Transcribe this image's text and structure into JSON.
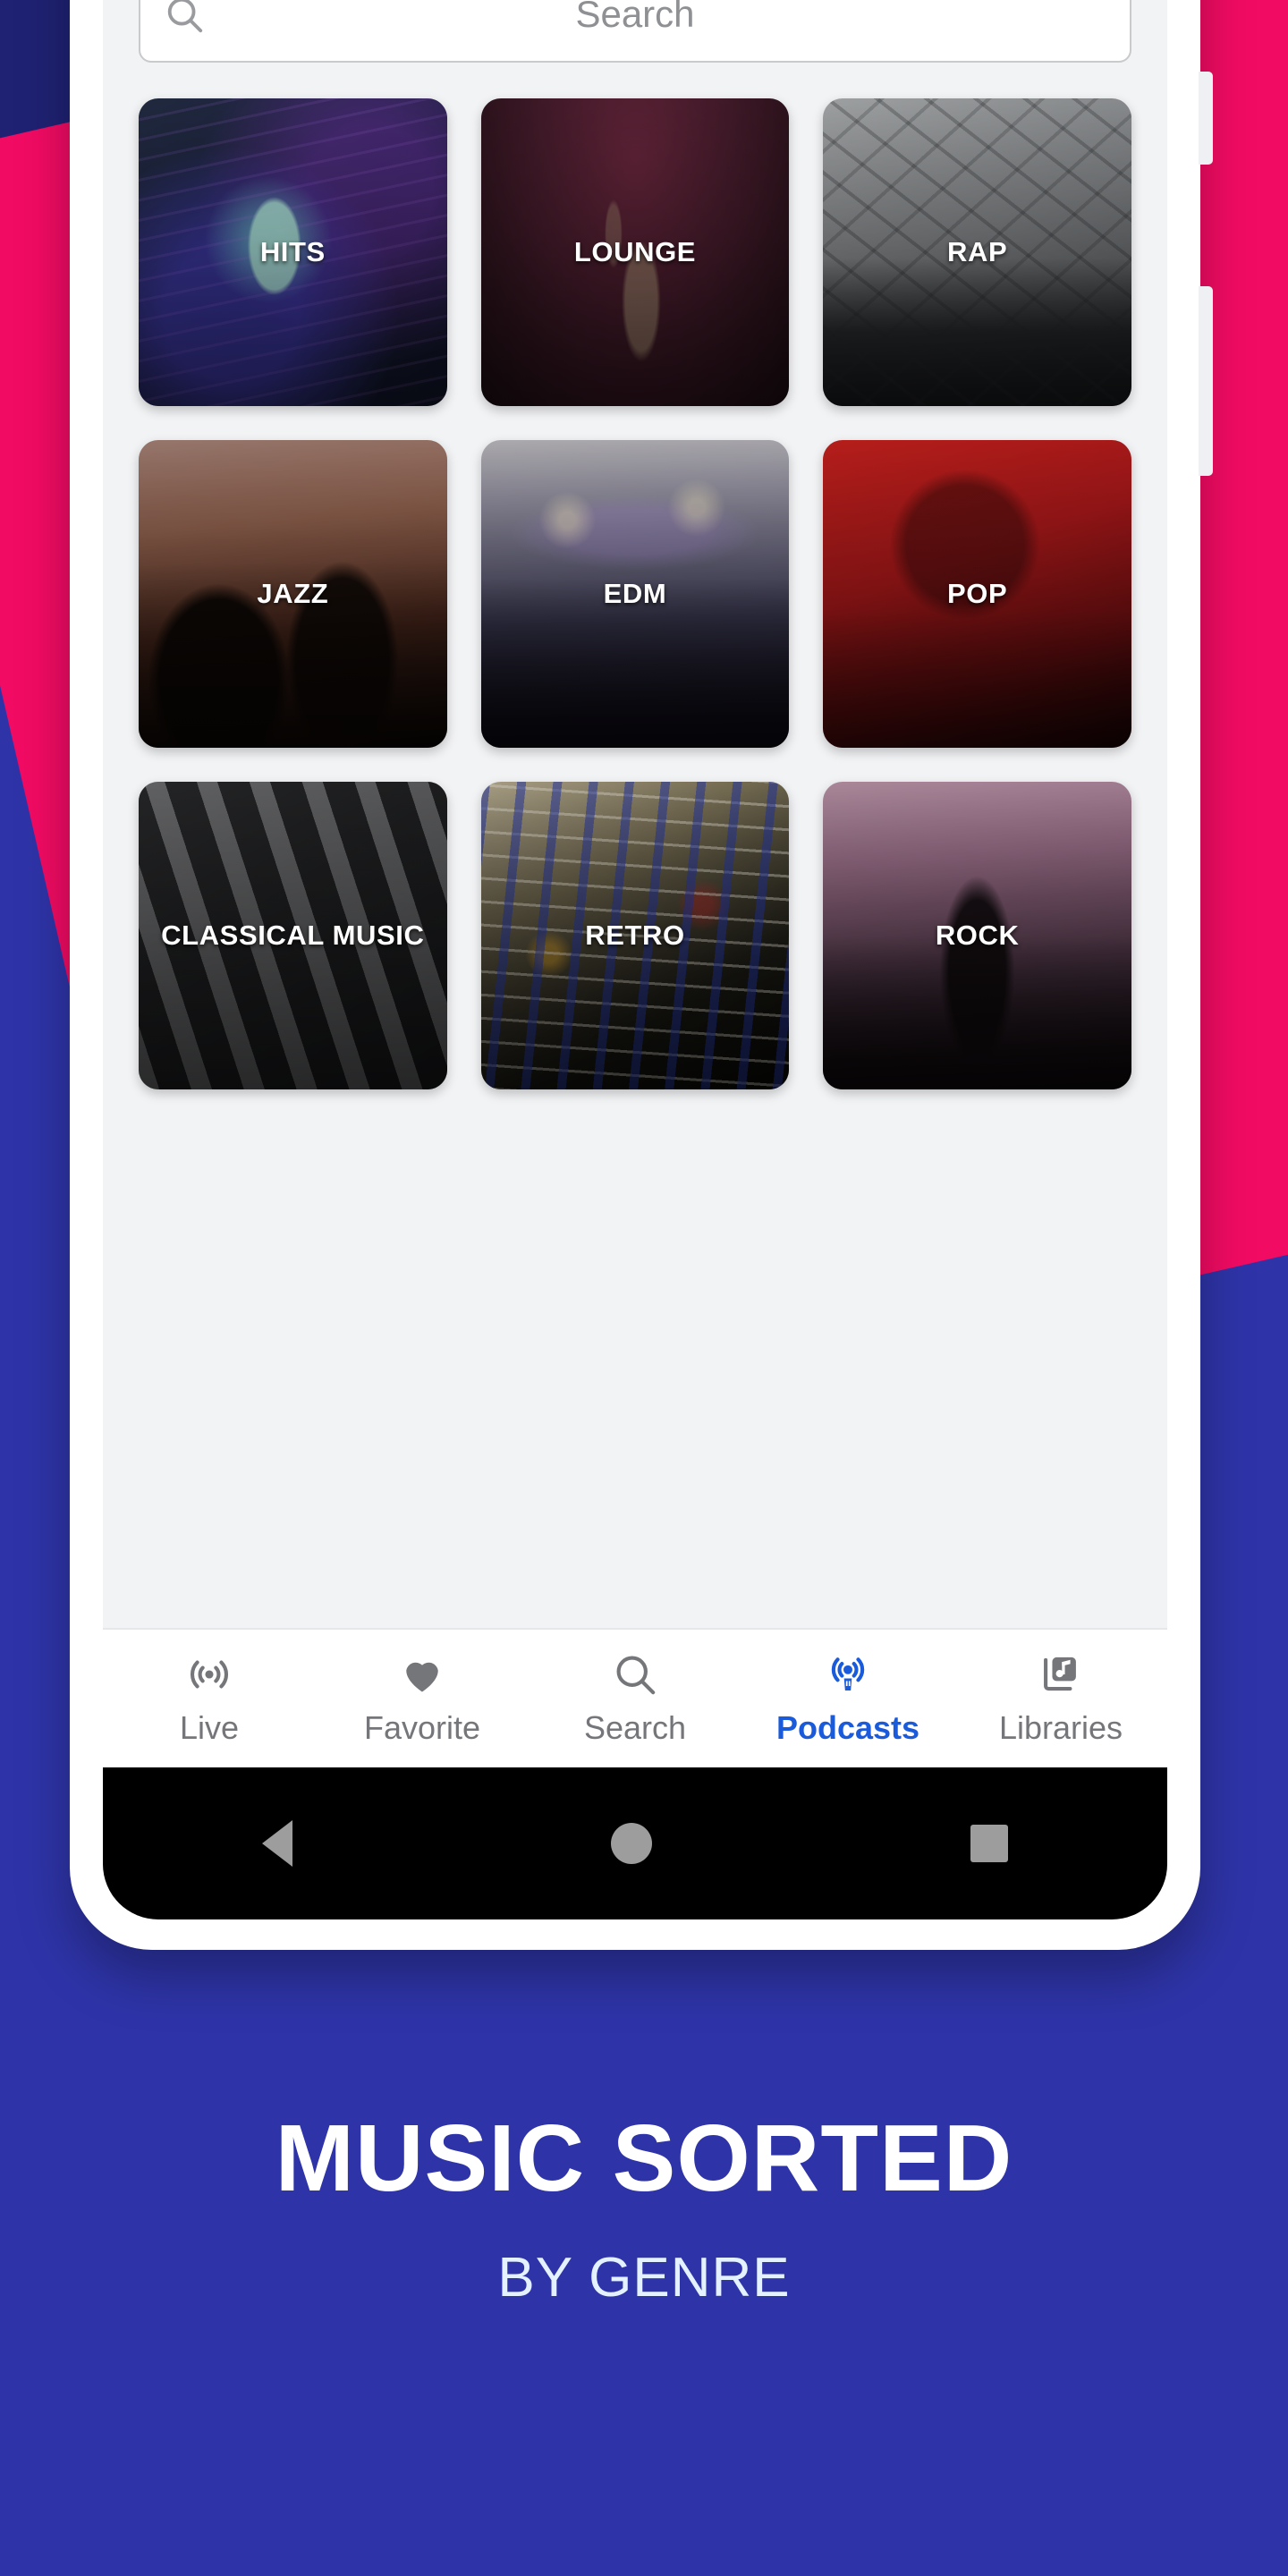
{
  "promo": {
    "headline": "MUSIC SORTED",
    "subhead": "BY GENRE",
    "background_color": "#2e34a8",
    "band_color": "#f20b63",
    "band_top_color": "#1f2273"
  },
  "search": {
    "placeholder": "Search",
    "value": "",
    "icon": "search-icon"
  },
  "genres": [
    {
      "label": "HITS",
      "art": "art-hits"
    },
    {
      "label": "LOUNGE",
      "art": "art-lounge"
    },
    {
      "label": "RAP",
      "art": "art-rap"
    },
    {
      "label": "JAZZ",
      "art": "art-jazz"
    },
    {
      "label": "EDM",
      "art": "art-edm"
    },
    {
      "label": "POP",
      "art": "art-pop"
    },
    {
      "label": "CLASSICAL MUSIC",
      "art": "art-classical"
    },
    {
      "label": "RETRO",
      "art": "art-retro"
    },
    {
      "label": "ROCK",
      "art": "art-rock"
    }
  ],
  "bottom_nav": {
    "active_color": "#1a5bdb",
    "inactive_color": "#75767a",
    "items": [
      {
        "label": "Live",
        "icon": "broadcast-icon",
        "active": false
      },
      {
        "label": "Favorite",
        "icon": "heart-icon",
        "active": false
      },
      {
        "label": "Search",
        "icon": "search-icon",
        "active": false
      },
      {
        "label": "Podcasts",
        "icon": "podcast-icon",
        "active": true
      },
      {
        "label": "Libraries",
        "icon": "music-library-icon",
        "active": false
      }
    ]
  },
  "system_nav": {
    "back": "back-button",
    "home": "home-button",
    "recents": "recents-button"
  }
}
